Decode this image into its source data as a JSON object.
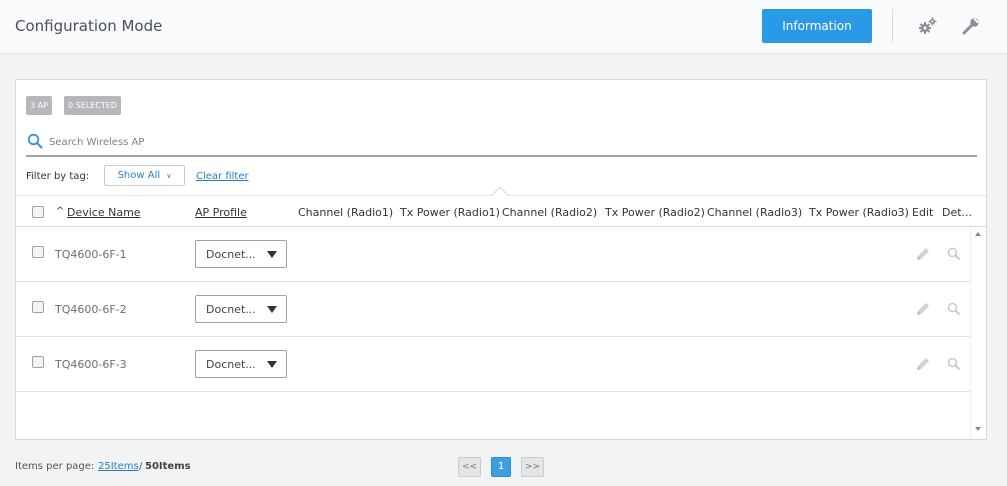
{
  "header": {
    "title": "Configuration Mode",
    "info_button": "Information",
    "icons": [
      "gears-icon",
      "wrench-icon"
    ]
  },
  "badges": {
    "ap_count": "3 AP",
    "selected": "0 SELECTED"
  },
  "search": {
    "placeholder": "Search Wireless AP",
    "value": ""
  },
  "filter": {
    "label": "Filter by tag:",
    "select_value": "Show All",
    "clear_label": "Clear filter"
  },
  "table": {
    "columns": [
      "Device Name",
      "AP Profile",
      "Channel (Radio1)",
      "Tx Power (Radio1)",
      "Channel (Radio2)",
      "Tx Power (Radio2)",
      "Channel (Radio3)",
      "Tx Power (Radio3)",
      "Edit",
      "Det..."
    ],
    "rows": [
      {
        "device": "TQ4600-6F-1",
        "profile": "Docnet..."
      },
      {
        "device": "TQ4600-6F-2",
        "profile": "Docnet..."
      },
      {
        "device": "TQ4600-6F-3",
        "profile": "Docnet..."
      }
    ]
  },
  "footer": {
    "items_label": "Items per page:",
    "option_25": "25Items",
    "separator": "/",
    "option_50": "50Items",
    "prev": "<<",
    "current_page": "1",
    "next": ">>"
  },
  "colors": {
    "accent": "#2b9ae6",
    "link": "#2b7fc2",
    "badge": "#b5b7ba"
  }
}
